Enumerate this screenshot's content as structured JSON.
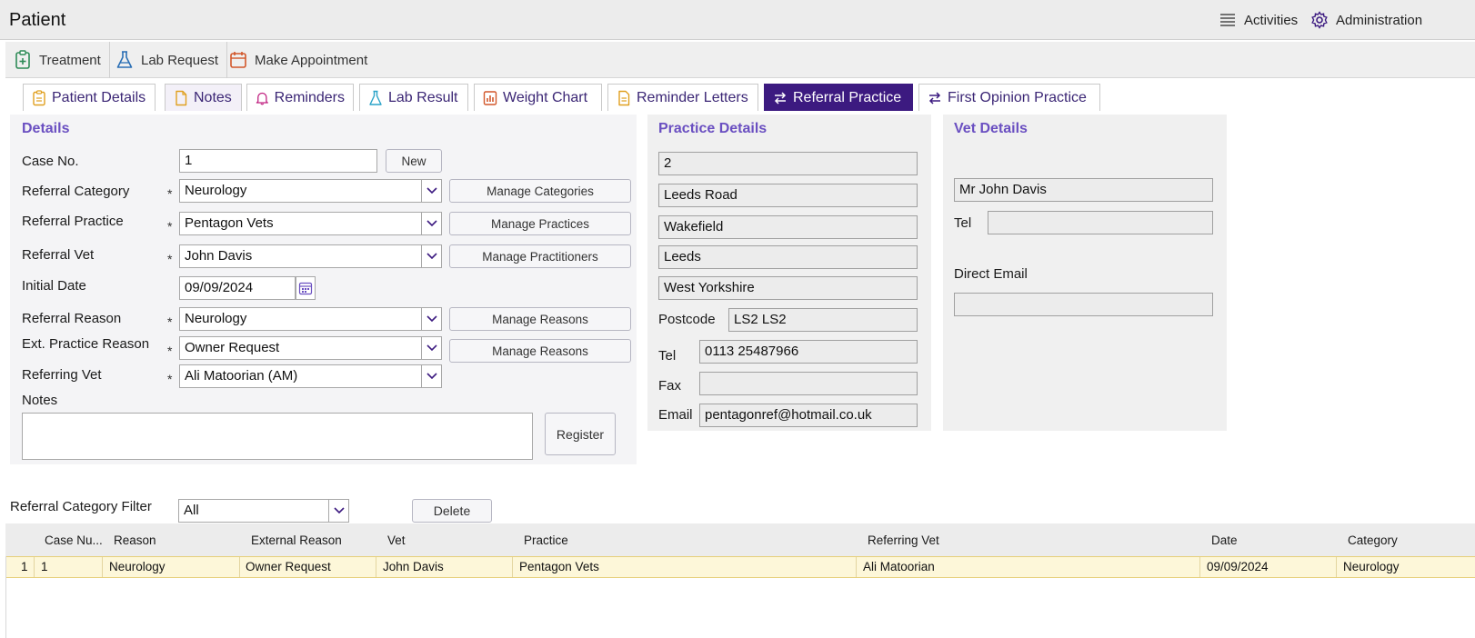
{
  "app": {
    "title": "Patient"
  },
  "top_links": [
    {
      "label": "Activities",
      "icon": "list-icon"
    },
    {
      "label": "Administration",
      "icon": "gear-icon"
    }
  ],
  "toolbar": [
    {
      "label": "Treatment",
      "icon": "clipboard-plus-icon"
    },
    {
      "label": "Lab Request",
      "icon": "flask-icon"
    },
    {
      "label": "Make Appointment",
      "icon": "calendar-icon"
    }
  ],
  "tabs": [
    {
      "label": "Patient Details",
      "icon": "clipboard-icon"
    },
    {
      "label": "Notes",
      "icon": "document-icon"
    },
    {
      "label": "Reminders",
      "icon": "bell-icon"
    },
    {
      "label": "Lab Result",
      "icon": "flask-icon"
    },
    {
      "label": "Weight Chart",
      "icon": "chart-icon"
    },
    {
      "label": "Reminder Letters",
      "icon": "letter-icon"
    },
    {
      "label": "Referral Practice",
      "icon": "swap-icon",
      "active": true
    },
    {
      "label": "First Opinion Practice",
      "icon": "swap-icon"
    }
  ],
  "details": {
    "title": "Details",
    "case_no_label": "Case No.",
    "case_no": "1",
    "new_button": "New",
    "referral_category_label": "Referral Category",
    "referral_category": "Neurology",
    "manage_categories": "Manage Categories",
    "referral_practice_label": "Referral Practice",
    "referral_practice": "Pentagon Vets",
    "manage_practices": "Manage Practices",
    "referral_vet_label": "Referral Vet",
    "referral_vet": "John Davis",
    "manage_practitioners": "Manage Practitioners",
    "initial_date_label": "Initial Date",
    "initial_date": "09/09/2024",
    "referral_reason_label": "Referral Reason",
    "referral_reason": "Neurology",
    "manage_reasons": "Manage Reasons",
    "ext_practice_reason_label": "Ext. Practice Reason",
    "ext_practice_reason": "Owner Request",
    "manage_reasons_2": "Manage Reasons",
    "referring_vet_label": "Referring Vet",
    "referring_vet": "Ali Matoorian (AM)",
    "notes_label": "Notes",
    "notes": "",
    "register_button": "Register",
    "required_mark": "*"
  },
  "practice_details": {
    "title": "Practice Details",
    "address_lines": [
      "2",
      "Leeds Road",
      "Wakefield",
      "Leeds",
      "West Yorkshire"
    ],
    "postcode_label": "Postcode",
    "postcode": "LS2 LS2",
    "tel_label": "Tel",
    "tel": "0113 25487966",
    "fax_label": "Fax",
    "fax": "",
    "email_label": "Email",
    "email": "pentagonref@hotmail.co.uk"
  },
  "vet_details": {
    "title": "Vet Details",
    "name": "Mr John Davis",
    "tel_label": "Tel",
    "tel": "",
    "direct_email_label": "Direct Email",
    "direct_email": ""
  },
  "filter": {
    "label": "Referral Category Filter",
    "value": "All",
    "delete_button": "Delete"
  },
  "grid": {
    "columns": [
      "Case Nu...",
      "Reason",
      "External Reason",
      "Vet",
      "Practice",
      "Referring Vet",
      "Date",
      "Category"
    ],
    "rows": [
      {
        "row_no": "1",
        "cells": [
          "1",
          "Neurology",
          "Owner Request",
          "John Davis",
          "Pentagon Vets",
          "Ali Matoorian",
          "09/09/2024",
          "Neurology"
        ]
      }
    ]
  },
  "colors": {
    "accent": "#3c1a80",
    "section_title": "#6a4fc1",
    "selected_row": "#fdf7d9"
  }
}
